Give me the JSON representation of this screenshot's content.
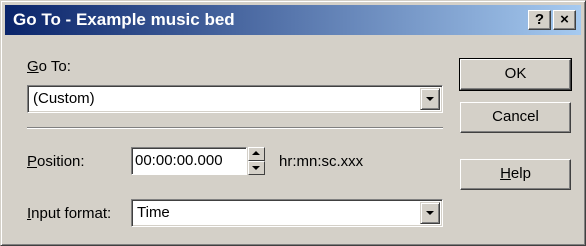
{
  "window": {
    "title": "Go To - Example music bed"
  },
  "titlebar_buttons": {
    "help": "?",
    "close": "×"
  },
  "goto": {
    "label_key": "G",
    "label_rest": "o To:",
    "value": "(Custom)"
  },
  "position": {
    "label_key": "P",
    "label_rest": "osition:",
    "value": "00:00:00.000",
    "units": "hr:mn:sc.xxx"
  },
  "input_format": {
    "label_key": "I",
    "label_rest": "nput format:",
    "value": "Time"
  },
  "buttons": {
    "ok": "OK",
    "cancel": "Cancel",
    "help_key": "H",
    "help_rest": "elp"
  }
}
